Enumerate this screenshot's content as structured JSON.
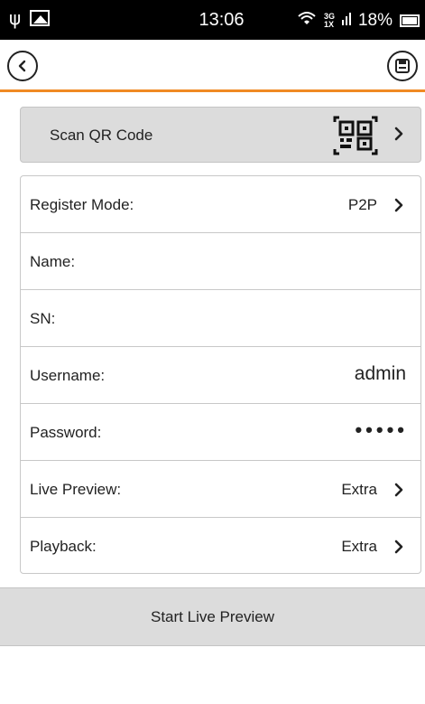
{
  "status_bar": {
    "time": "13:06",
    "network": [
      "3G",
      "1X"
    ],
    "battery_percent": "18%",
    "usb_icon": "usb-icon",
    "image_icon": "image-notification-icon",
    "wifi_icon": "wifi-icon",
    "battery_icon": "battery-charging-icon"
  },
  "toolbar": {
    "back_icon": "chevron-left-icon",
    "save_icon": "save-icon",
    "accent_color": "#f08a24"
  },
  "scan": {
    "label": "Scan QR Code",
    "icon": "qr-code-icon"
  },
  "form": {
    "rows": [
      {
        "label": "Register Mode:",
        "value": "P2P",
        "chevron": true
      },
      {
        "label": "Name:",
        "value": ""
      },
      {
        "label": "SN:",
        "value": ""
      },
      {
        "label": "Username:",
        "value": "admin"
      },
      {
        "label": "Password:",
        "value": "•••••"
      },
      {
        "label": "Live Preview:",
        "value": "Extra",
        "chevron": true
      },
      {
        "label": "Playback:",
        "value": "Extra",
        "chevron": true
      }
    ]
  },
  "start_button": {
    "label": "Start Live Preview"
  }
}
